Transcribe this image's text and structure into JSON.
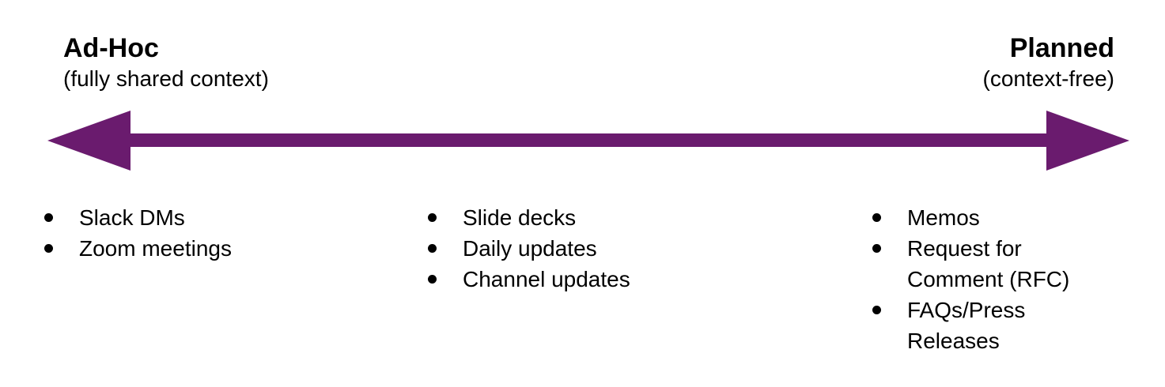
{
  "left_end": {
    "title": "Ad-Hoc",
    "subtitle": "(fully shared context)"
  },
  "right_end": {
    "title": "Planned",
    "subtitle": "(context-free)"
  },
  "arrow_color": "#6a1b6e",
  "columns": {
    "left": [
      "Slack DMs",
      "Zoom meetings"
    ],
    "middle": [
      "Slide decks",
      "Daily updates",
      "Channel updates"
    ],
    "right": [
      "Memos",
      "Request for Comment (RFC)",
      "FAQs/Press Releases"
    ]
  }
}
